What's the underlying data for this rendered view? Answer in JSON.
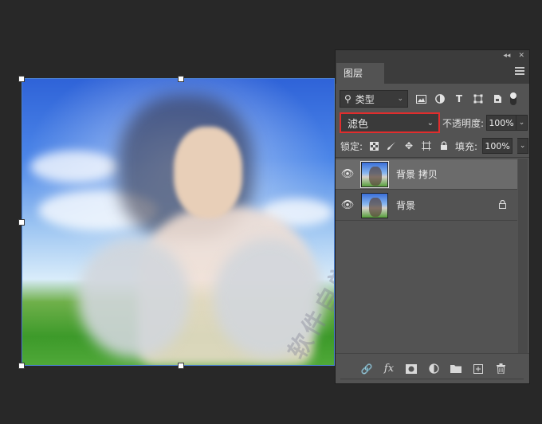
{
  "panel": {
    "collapse_icon": "double-chevron-left-icon",
    "close_icon": "close-icon",
    "collapse_glyph": "◂◂",
    "close_glyph": "✕",
    "tab_label": "图层",
    "menu_icon": "hamburger-icon"
  },
  "filter": {
    "kind_label": "类型",
    "search_icon": "search-icon",
    "icons": [
      "image-filter-icon",
      "adjustment-filter-icon",
      "type-filter-icon",
      "shape-filter-icon",
      "smart-object-filter-icon"
    ]
  },
  "blend": {
    "mode": "滤色",
    "opacity_label": "不透明度:",
    "opacity_value": "100%"
  },
  "lock": {
    "label": "锁定:",
    "icons": [
      "lock-transparent-icon",
      "lock-pixels-icon",
      "lock-position-icon",
      "lock-artboard-icon",
      "lock-all-icon"
    ],
    "fill_label": "填充:",
    "fill_value": "100%"
  },
  "layers": [
    {
      "name": "背景 拷贝",
      "visible": true,
      "selected": true,
      "locked": false
    },
    {
      "name": "背景",
      "visible": true,
      "selected": false,
      "locked": true
    }
  ],
  "bottom_icons": [
    "link-layers-icon",
    "fx-icon",
    "layer-mask-icon",
    "adjustment-layer-icon",
    "new-group-icon",
    "new-layer-icon",
    "trash-icon"
  ],
  "fx_label": "fx",
  "canvas": {
    "watermark_text": "软件自学网 www.rjzxw.com"
  },
  "colors": {
    "highlight_border": "#e12d2d",
    "selection_border": "#4a7fd0",
    "panel_bg": "#535353",
    "app_bg": "#282828"
  }
}
